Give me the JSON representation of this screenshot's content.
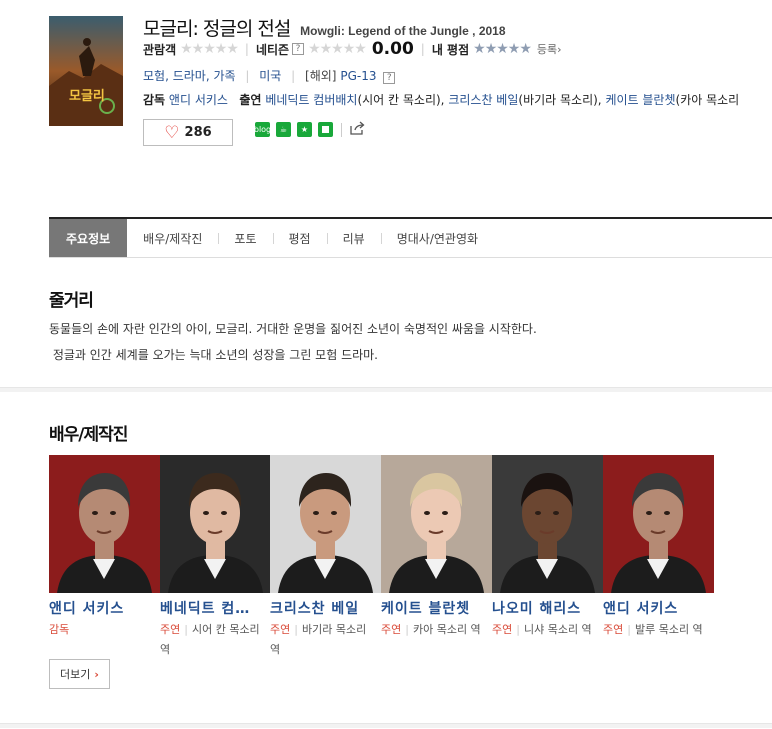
{
  "movie": {
    "title_ko": "모글리: 정글의 전설",
    "title_en": "Mowgli: Legend of the Jungle , 2018",
    "poster_text": "모글리",
    "rating": {
      "audience_label": "관람객",
      "netizen_label": "네티즌",
      "netizen_score": "0.00",
      "my_label": "내 평점",
      "register_label": "등록",
      "help_glyph": "?"
    },
    "genres": "모험, 드라마, 가족",
    "country": "미국",
    "grade_label": "[해외]",
    "grade": "PG-13",
    "director_label": "감독",
    "director": "앤디 서키스",
    "cast_label": "출연",
    "cast_line": [
      {
        "name": "베네딕트 컴버배치",
        "role": "(시어 칸 목소리), "
      },
      {
        "name": "크리스찬 베일",
        "role": "(바기라 목소리), "
      },
      {
        "name": "케이트 블란쳇",
        "role": "(카아 목소리"
      }
    ],
    "likes": "286"
  },
  "share": [
    {
      "icon": "blog-icon",
      "label": "blog",
      "color": "#19a83a"
    },
    {
      "icon": "cafe-icon",
      "label": "☕",
      "color": "#19a83a"
    },
    {
      "icon": "star-share-icon",
      "label": "★",
      "color": "#19a83a"
    },
    {
      "icon": "square-share-icon",
      "label": "",
      "color": "#19a83a"
    }
  ],
  "tabs": [
    "주요정보",
    "배우/제작진",
    "포토",
    "평점",
    "리뷰",
    "명대사/연관영화"
  ],
  "synopsis": {
    "heading": "줄거리",
    "lines": [
      "동물들의 손에 자란 인간의 아이, 모글리. 거대한 운명을 짊어진 소년이 숙명적인 싸움을 시작한다.",
      " 정글과 인간 세계를 오가는 늑대 소년의 성장을 그린 모험 드라마."
    ]
  },
  "cast_section": {
    "heading": "배우/제작진",
    "more_label": "더보기",
    "people": [
      {
        "name": "앤디 서키스",
        "kind": "감독",
        "role": "",
        "bg": "#8c1c1c",
        "skin": "#b58a74",
        "hair": "#3a3a3a"
      },
      {
        "name": "베네딕트 컴버배치",
        "display": "베네딕트 컴…",
        "kind": "주연",
        "role": "시어 칸 목소리 역",
        "bg": "#2a2a2a",
        "skin": "#e0b9a2",
        "hair": "#3c2a1d"
      },
      {
        "name": "크리스찬 베일",
        "kind": "주연",
        "role": "바기라 목소리 역",
        "bg": "#d8d8d8",
        "skin": "#c99a7e",
        "hair": "#2d241d"
      },
      {
        "name": "케이트 블란쳇",
        "kind": "주연",
        "role": "카아 목소리 역",
        "bg": "#b7a89a",
        "skin": "#ecc9b4",
        "hair": "#d9c6a0"
      },
      {
        "name": "나오미 해리스",
        "kind": "주연",
        "role": "니샤 목소리 역",
        "bg": "#3a3a3a",
        "skin": "#6b4631",
        "hair": "#1a1210"
      },
      {
        "name": "앤디 서키스",
        "kind": "주연",
        "role": "발루 목소리 역",
        "bg": "#8c1c1c",
        "skin": "#b58a74",
        "hair": "#3a3a3a"
      }
    ]
  }
}
